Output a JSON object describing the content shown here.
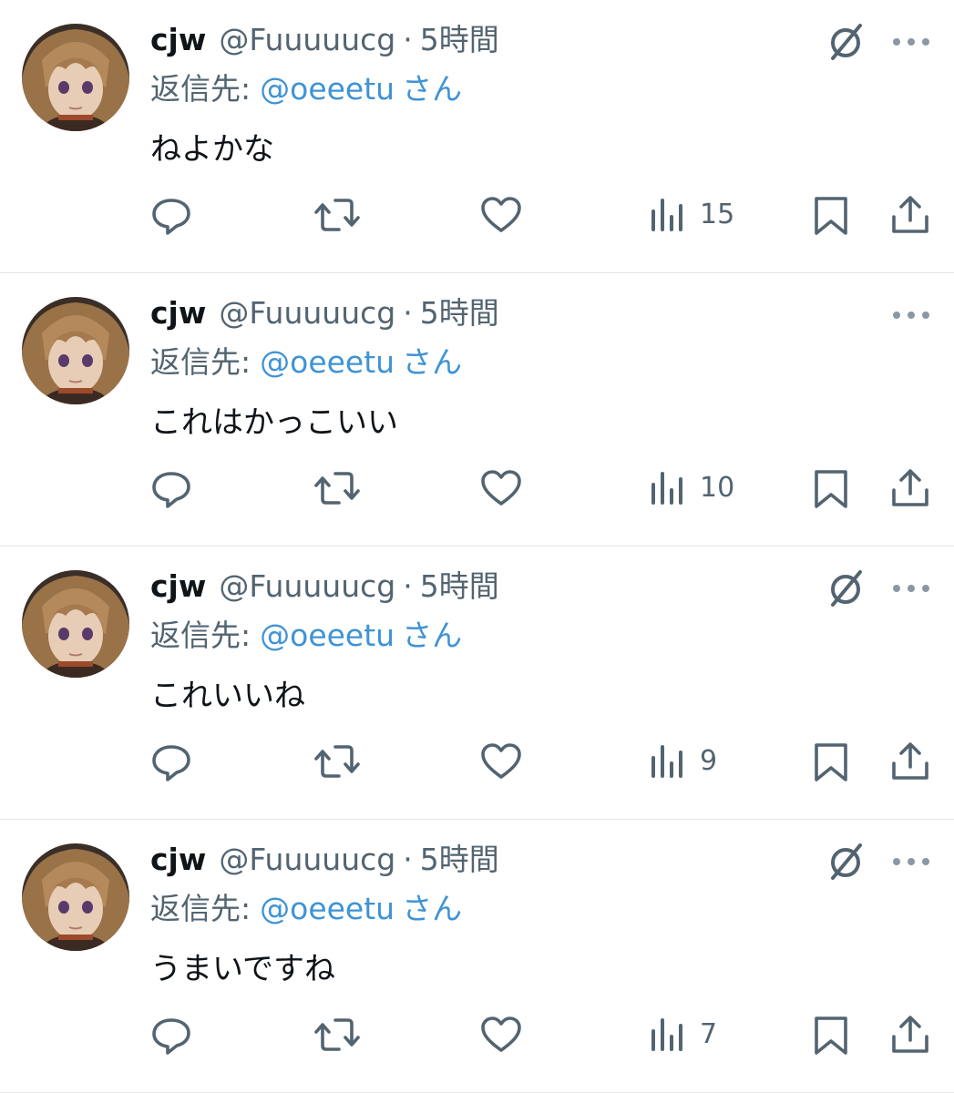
{
  "colors": {
    "link": "#3f93d6",
    "muted": "#536471",
    "text": "#0f1419",
    "divider": "#e6e6e6"
  },
  "tweets": [
    {
      "display_name": "cjw",
      "handle": "@Fuuuuucg",
      "separator": "·",
      "time": "5時間",
      "reply_prefix": "返信先:",
      "reply_handle": "@oeeetu",
      "reply_suffix": "さん",
      "text": "ねよかな",
      "views": "15",
      "has_grok_icon": true,
      "icons": [
        "avatar",
        "grok-icon",
        "more-icon",
        "reply-icon",
        "retweet-icon",
        "like-icon",
        "views-icon",
        "bookmark-icon",
        "share-icon"
      ]
    },
    {
      "display_name": "cjw",
      "handle": "@Fuuuuucg",
      "separator": "·",
      "time": "5時間",
      "reply_prefix": "返信先:",
      "reply_handle": "@oeeetu",
      "reply_suffix": "さん",
      "text": "これはかっこいい",
      "views": "10",
      "has_grok_icon": false,
      "icons": [
        "avatar",
        "more-icon",
        "reply-icon",
        "retweet-icon",
        "like-icon",
        "views-icon",
        "bookmark-icon",
        "share-icon"
      ]
    },
    {
      "display_name": "cjw",
      "handle": "@Fuuuuucg",
      "separator": "·",
      "time": "5時間",
      "reply_prefix": "返信先:",
      "reply_handle": "@oeeetu",
      "reply_suffix": "さん",
      "text": "これいいね",
      "views": "9",
      "has_grok_icon": true,
      "icons": [
        "avatar",
        "grok-icon",
        "more-icon",
        "reply-icon",
        "retweet-icon",
        "like-icon",
        "views-icon",
        "bookmark-icon",
        "share-icon"
      ]
    },
    {
      "display_name": "cjw",
      "handle": "@Fuuuuucg",
      "separator": "·",
      "time": "5時間",
      "reply_prefix": "返信先:",
      "reply_handle": "@oeeetu",
      "reply_suffix": "さん",
      "text": "うまいですね",
      "views": "7",
      "has_grok_icon": true,
      "icons": [
        "avatar",
        "grok-icon",
        "more-icon",
        "reply-icon",
        "retweet-icon",
        "like-icon",
        "views-icon",
        "bookmark-icon",
        "share-icon"
      ]
    }
  ]
}
